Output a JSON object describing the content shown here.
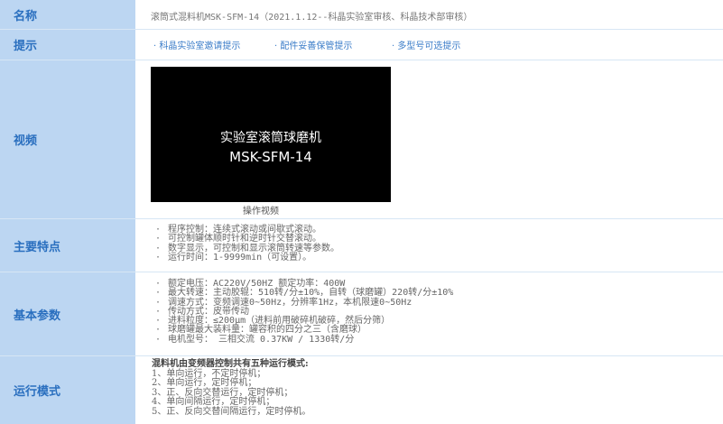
{
  "name": {
    "label": "名称",
    "value": "滚筒式混料机MSK-SFM-14（2021.1.12--科晶实验室审核、科晶技术部审核）"
  },
  "tips": {
    "label": "提示",
    "items": [
      "· 科晶实验室邀请提示",
      "· 配件妥善保管提示",
      "· 多型号可选提示"
    ]
  },
  "video": {
    "label": "视频",
    "line1": "实验室滚筒球磨机",
    "line2": "MSK-SFM-14",
    "caption": "操作视频"
  },
  "features": {
    "label": "主要特点",
    "items": [
      "程序控制：连续式滚动或间歇式滚动。",
      "可控制罐体顺时针和逆时针交替滚动。",
      "数字显示，可控制和显示滚筒转速等参数。",
      "运行时间：1-9999min（可设置）。"
    ]
  },
  "params": {
    "label": "基本参数",
    "items": [
      "额定电压：AC220V/50HZ   额定功率：400W",
      "最大转速：主动胶辊：510转/分±10%，自转（球磨罐）220转/分±10%",
      "调速方式：变频调速0~50Hz，分辨率1Hz，本机限速0~50Hz",
      "传动方式：皮带传动",
      "进料粒度：≤200μm（进料前用破碎机破碎，然后分筛）",
      "球磨罐最大装料量：罐容积的四分之三（含磨球）",
      "电机型号：  三相交流 0.37KW / 1330转/分"
    ]
  },
  "modes": {
    "label": "运行模式",
    "heading": "混料机由变频器控制共有五种运行模式:",
    "items": [
      "1、单向运行，不定时停机；",
      "2、单向运行，定时停机；",
      "3、正、反向交替运行，定时停机；",
      "4、单向间隔运行，定时停机；",
      "5、正、反向交替间隔运行，定时停机。"
    ]
  }
}
